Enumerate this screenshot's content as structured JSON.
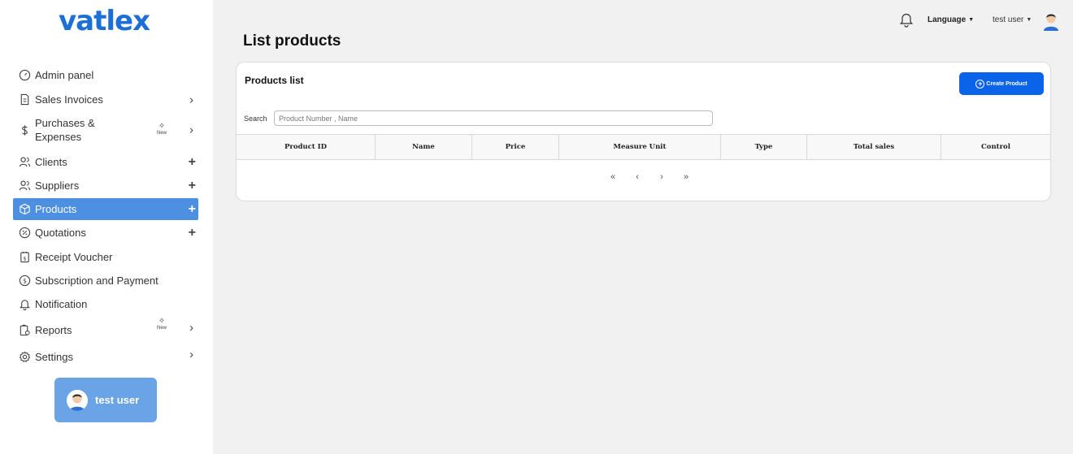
{
  "app": {
    "logo": "vatlex"
  },
  "sidebar": {
    "items": [
      {
        "label": "Admin panel",
        "icon": "gauge-icon",
        "suffix": ""
      },
      {
        "label": "Sales Invoices",
        "icon": "invoice-icon",
        "suffix": "chevron"
      },
      {
        "label": "Purchases &\nExpenses",
        "icon": "dollar-icon",
        "suffix": "chevron",
        "badge": "New"
      },
      {
        "label": "Clients",
        "icon": "users-icon",
        "suffix": "plus"
      },
      {
        "label": "Suppliers",
        "icon": "users-icon",
        "suffix": "plus"
      },
      {
        "label": "Products",
        "icon": "box-icon",
        "suffix": "plus",
        "active": true
      },
      {
        "label": "Quotations",
        "icon": "percent-icon",
        "suffix": "plus"
      },
      {
        "label": "Receipt Voucher",
        "icon": "receipt-icon",
        "suffix": ""
      },
      {
        "label": "Subscription and Payment",
        "icon": "dollar-circle-icon",
        "suffix": ""
      },
      {
        "label": "Notification",
        "icon": "bell-icon",
        "suffix": ""
      },
      {
        "label": "Reports",
        "icon": "report-icon",
        "suffix": "chevron",
        "badge": "New"
      },
      {
        "label": "Settings",
        "icon": "gear-icon",
        "suffix": "chevron"
      }
    ],
    "user_card": {
      "name": "test user"
    }
  },
  "topbar": {
    "language": "Language",
    "user": "test user"
  },
  "page": {
    "title": "List products"
  },
  "card": {
    "title": "Products list",
    "create_button": "Create Product",
    "search_label": "Search",
    "search_placeholder": "Product Number , Name",
    "columns": [
      "Product ID",
      "Name",
      "Price",
      "Measure Unit",
      "Type",
      "Total sales",
      "Control"
    ],
    "pagination": [
      "«",
      "‹",
      "›",
      "»"
    ]
  },
  "colors": {
    "brand": "#1c6fd6",
    "active": "#4d8fe0",
    "button": "#0a63e8",
    "user_card": "#6aa3e6"
  }
}
